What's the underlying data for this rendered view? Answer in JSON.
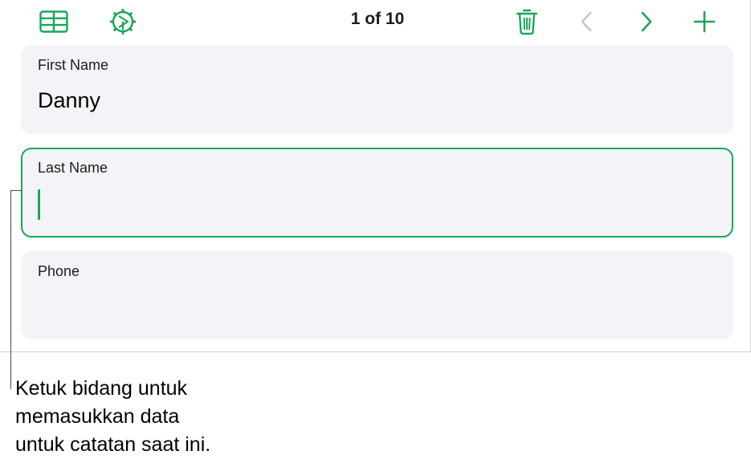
{
  "toolbar": {
    "record_counter": "1 of 10",
    "icons": {
      "table": "table-grid-icon",
      "settings": "gear-icon",
      "delete": "trash-icon",
      "previous": "chevron-left-icon",
      "next": "chevron-right-icon",
      "add": "plus-icon"
    },
    "accent_color": "#17a858",
    "disabled_color": "#c7c7cc"
  },
  "fields": [
    {
      "label": "First Name",
      "value": "Danny",
      "active": false
    },
    {
      "label": "Last Name",
      "value": "",
      "active": true
    },
    {
      "label": "Phone",
      "value": "",
      "active": false
    }
  ],
  "callout": {
    "lines": [
      "Ketuk bidang untuk",
      "memasukkan data",
      "untuk catatan saat ini."
    ]
  }
}
